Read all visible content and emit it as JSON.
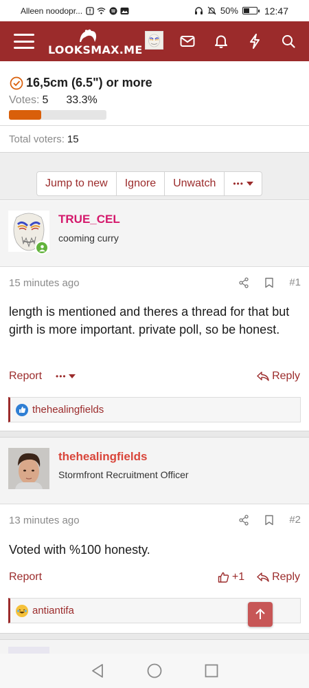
{
  "status_bar": {
    "carrier_text": "Alleen noodopr...",
    "battery": "50%",
    "battery_level": 0.5,
    "time": "12:47"
  },
  "header": {
    "site_name": "LOOKSMAX.ME",
    "brand_color": "#9b2b2b",
    "icons": [
      "menu-icon",
      "avatar",
      "mail-icon",
      "bell-icon",
      "bolt-icon",
      "search-icon"
    ]
  },
  "poll": {
    "option_label": "16,5cm (6.5\") or more",
    "votes_label": "Votes:",
    "votes": "5",
    "percent": "33.3%",
    "percent_value": 33.3,
    "bar_color": "#d95f0a",
    "total_label": "Total voters:",
    "total": "15"
  },
  "thread_actions": {
    "jump": "Jump to new",
    "ignore": "Ignore",
    "unwatch": "Unwatch",
    "more": "•••"
  },
  "posts": [
    {
      "username": "TRUE_CEL",
      "username_color": "#d4186b",
      "user_title": "cooming curry",
      "time": "15 minutes ago",
      "number": "#1",
      "body": "length is mentioned and theres a thread for that but girth is more important. private poll, so be honest.",
      "report": "Report",
      "more": "•••",
      "reply": "Reply",
      "reactions": "thehealingfields",
      "reaction_icon": "like-icon"
    },
    {
      "username": "thehealingfields",
      "username_color": "#d9463b",
      "user_title": "Stormfront Recruitment Officer",
      "time": "13 minutes ago",
      "number": "#2",
      "body": "Voted with %100 honesty.",
      "report": "Report",
      "react_label": "+1",
      "reply": "Reply",
      "reactions": "antiantifa",
      "reaction_icon": "laughing-emoji-icon"
    }
  ]
}
